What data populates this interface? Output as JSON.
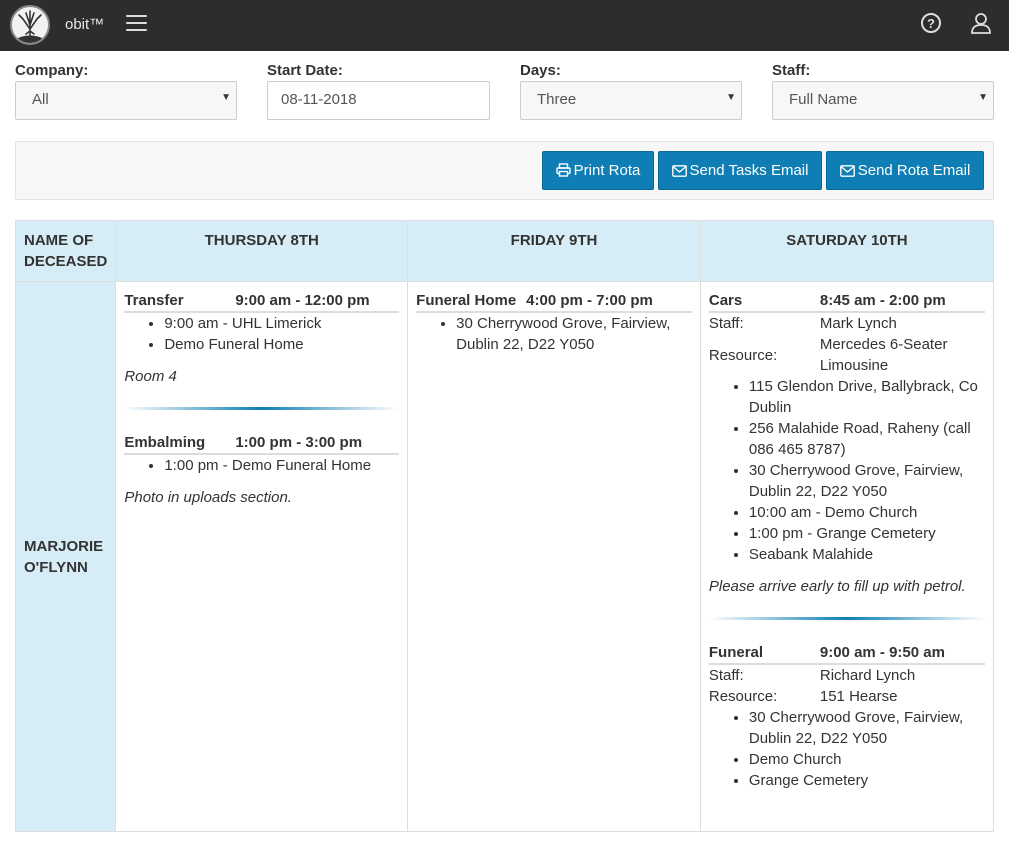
{
  "app": {
    "brand": "obit™"
  },
  "filters": {
    "company": {
      "label": "Company:",
      "value": "All"
    },
    "start_date": {
      "label": "Start Date:",
      "value": "08-11-2018"
    },
    "days": {
      "label": "Days:",
      "value": "Three"
    },
    "staff": {
      "label": "Staff:",
      "value": "Full Name"
    }
  },
  "actions": {
    "print_rota": "Print Rota",
    "send_tasks_email": "Send Tasks Email",
    "send_rota_email": "Send Rota Email"
  },
  "table": {
    "headers": {
      "name": "NAME OF DECEASED",
      "days": [
        "THURSDAY 8TH",
        "FRIDAY 9TH",
        "SATURDAY 10TH"
      ]
    },
    "deceased": "MARJORIE O'FLYNN",
    "thursday": {
      "task1": {
        "name": "Transfer",
        "time": "9:00 am - 12:00 pm",
        "stops": [
          "9:00 am - UHL Limerick",
          "Demo Funeral Home"
        ],
        "note": "Room 4"
      },
      "task2": {
        "name": "Embalming",
        "time": "1:00 pm - 3:00 pm",
        "stops": [
          "1:00 pm - Demo Funeral Home"
        ],
        "note": "Photo in uploads section."
      }
    },
    "friday": {
      "task1": {
        "name": "Funeral Home",
        "time": "4:00 pm - 7:00 pm",
        "stops": [
          "30 Cherrywood Grove, Fairview, Dublin 22, D22 Y050"
        ]
      }
    },
    "saturday": {
      "task1": {
        "name": "Cars",
        "time": "8:45 am - 2:00 pm",
        "staff_label": "Staff:",
        "staff": "Mark Lynch",
        "resource_label": "Resource:",
        "resource": "Mercedes 6-Seater Limousine",
        "stops": [
          "115 Glendon Drive, Ballybrack, Co Dublin",
          "256 Malahide Road, Raheny (call 086 465 8787)",
          "30 Cherrywood Grove, Fairview, Dublin 22, D22 Y050",
          "10:00 am - Demo Church",
          "1:00 pm - Grange Cemetery",
          "Seabank Malahide"
        ],
        "note": "Please arrive early to fill up with petrol."
      },
      "task2": {
        "name": "Funeral",
        "time": "9:00 am - 9:50 am",
        "staff_label": "Staff:",
        "staff": "Richard Lynch",
        "resource_label": "Resource:",
        "resource": "151 Hearse",
        "stops": [
          "30 Cherrywood Grove, Fairview, Dublin 22, D22 Y050",
          "Demo Church",
          "Grange Cemetery"
        ]
      }
    }
  },
  "icons": [
    "tree-logo-icon",
    "hamburger-menu-icon",
    "help-icon",
    "user-icon",
    "printer-icon",
    "envelope-icon"
  ],
  "colors": {
    "topbar": "#2d2d2d",
    "accent": "#0e7eb4",
    "header_bg": "#d6ecf6"
  }
}
